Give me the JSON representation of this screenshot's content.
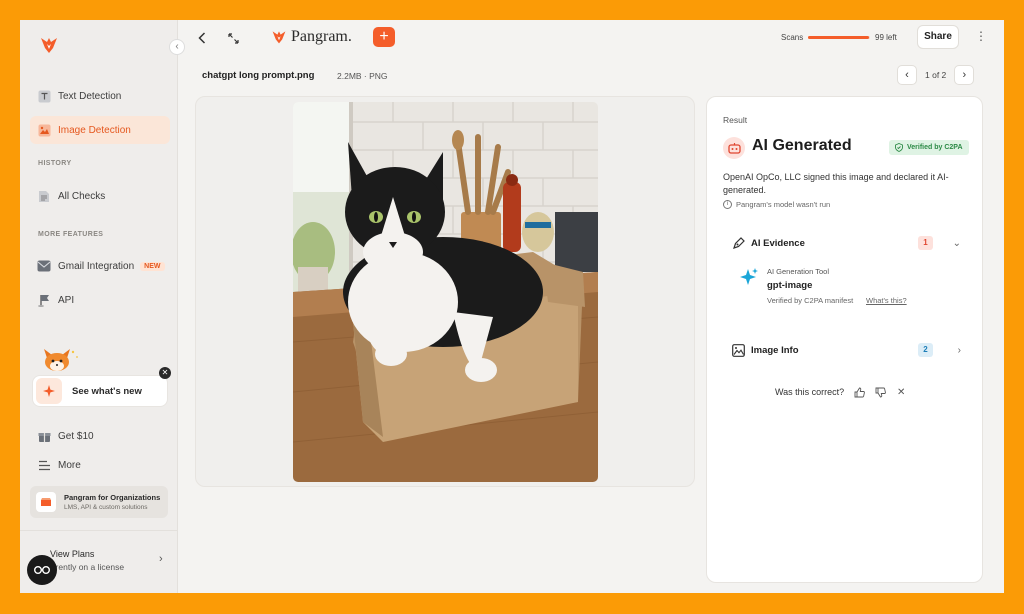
{
  "sidebar": {
    "text_detection": "Text Detection",
    "image_detection": "Image Detection",
    "history_label": "HISTORY",
    "all_checks": "All Checks",
    "more_features_label": "MORE FEATURES",
    "gmail_integration": "Gmail Integration",
    "gmail_badge": "NEW",
    "api": "API",
    "whats_new": "See what's new",
    "get_10": "Get $10",
    "more": "More",
    "org_title": "Pangram for Organizations",
    "org_sub": "LMS, API & custom solutions",
    "view_plans": "View Plans",
    "license_text": "urrently on a license"
  },
  "header": {
    "brand": "Pangram.",
    "scans_label": "Scans",
    "scans_left": "99 left",
    "scans_fraction": 0.99,
    "share": "Share"
  },
  "file": {
    "name": "chatgpt long prompt.png",
    "info": "2.2MB · PNG",
    "pager": "1 of 2"
  },
  "result": {
    "label": "Result",
    "title": "AI Generated",
    "verified_badge": "Verified by C2PA",
    "description": "OpenAI OpCo, LLC signed this image and declared it AI-generated.",
    "note": "Pangram's model wasn't run",
    "ai_evidence": "AI Evidence",
    "ai_evidence_count": "1",
    "tool_label": "AI Generation Tool",
    "tool_name": "gpt-image",
    "tool_sub": "Verified by C2PA manifest",
    "tool_link": "What's this?",
    "image_info": "Image Info",
    "image_info_count": "2",
    "feedback_question": "Was this correct?"
  },
  "colors": {
    "accent": "#f45d2a",
    "frame": "#fb9b06",
    "verified_green": "#2c8a46"
  }
}
